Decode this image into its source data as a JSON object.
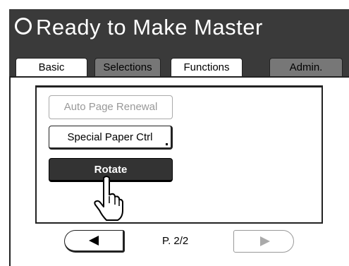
{
  "header": {
    "title": "Ready to Make Master",
    "status_icon": "circle-icon"
  },
  "tabs": [
    {
      "label": "Basic"
    },
    {
      "label": "Selections"
    },
    {
      "label": "Functions"
    },
    {
      "label": "Admin."
    }
  ],
  "active_tab": "Functions",
  "buttons": {
    "auto_page_renewal": "Auto Page Renewal",
    "special_paper_ctrl": "Special Paper Ctrl",
    "rotate": "Rotate"
  },
  "pager": {
    "label": "P. 2/2",
    "prev_icon": "arrow-left-icon",
    "next_icon": "arrow-right-icon"
  },
  "colors": {
    "header_bg": "#3a3a3a",
    "inactive_tab": "#777777",
    "selected_button": "#333333"
  }
}
